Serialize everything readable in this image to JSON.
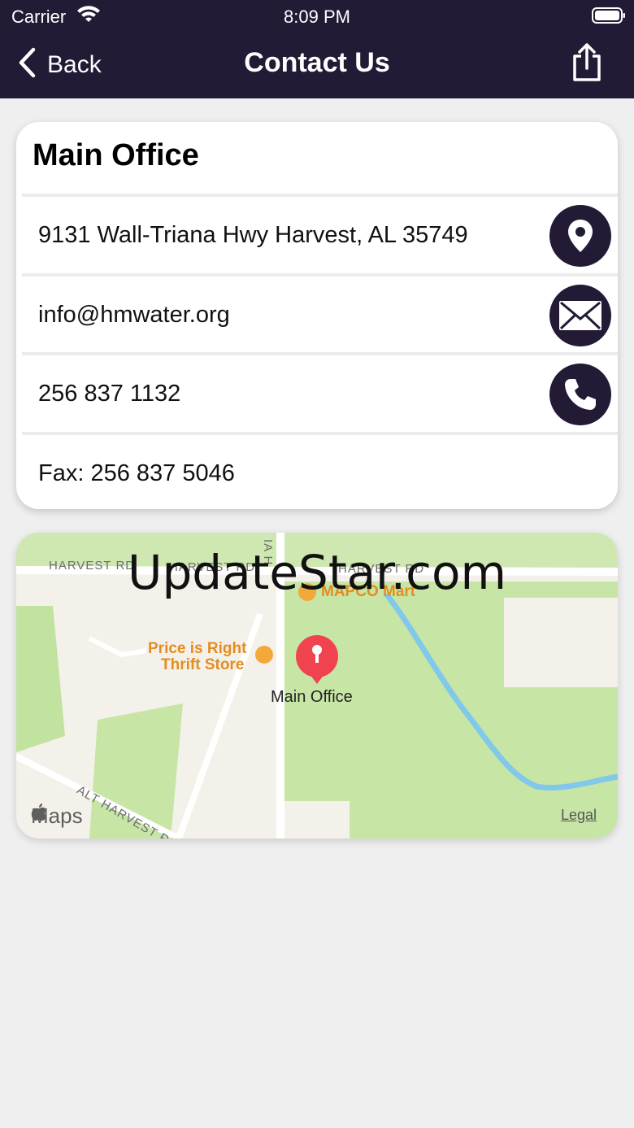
{
  "status": {
    "carrier": "Carrier",
    "time": "8:09 PM"
  },
  "nav": {
    "back_label": "Back",
    "title": "Contact Us"
  },
  "card": {
    "heading": "Main Office",
    "address": "9131 Wall-Triana Hwy Harvest, AL 35749",
    "email": "info@hmwater.org",
    "phone": "256 837 1132",
    "fax": "Fax: 256 837 5046"
  },
  "map": {
    "watermark": "UpdateStar.com",
    "road_harvest_1": "HARVEST RD",
    "road_harvest_2": "HARVEST RD",
    "road_harvest_3": "HARVEST RD",
    "road_vertical": "IA H",
    "road_alt": "ALT HARVEST RD",
    "poi_mapco": "MAPCO Mart",
    "poi_price_line1": "Price is Right",
    "poi_price_line2": "Thrift Store",
    "pin_label": "Main Office",
    "maps_logo": "Maps",
    "legal": "Legal"
  },
  "colors": {
    "navbar": "#231a35",
    "accent_circle": "#231a35",
    "pin": "#f0434f",
    "poi": "#e58c1f"
  }
}
